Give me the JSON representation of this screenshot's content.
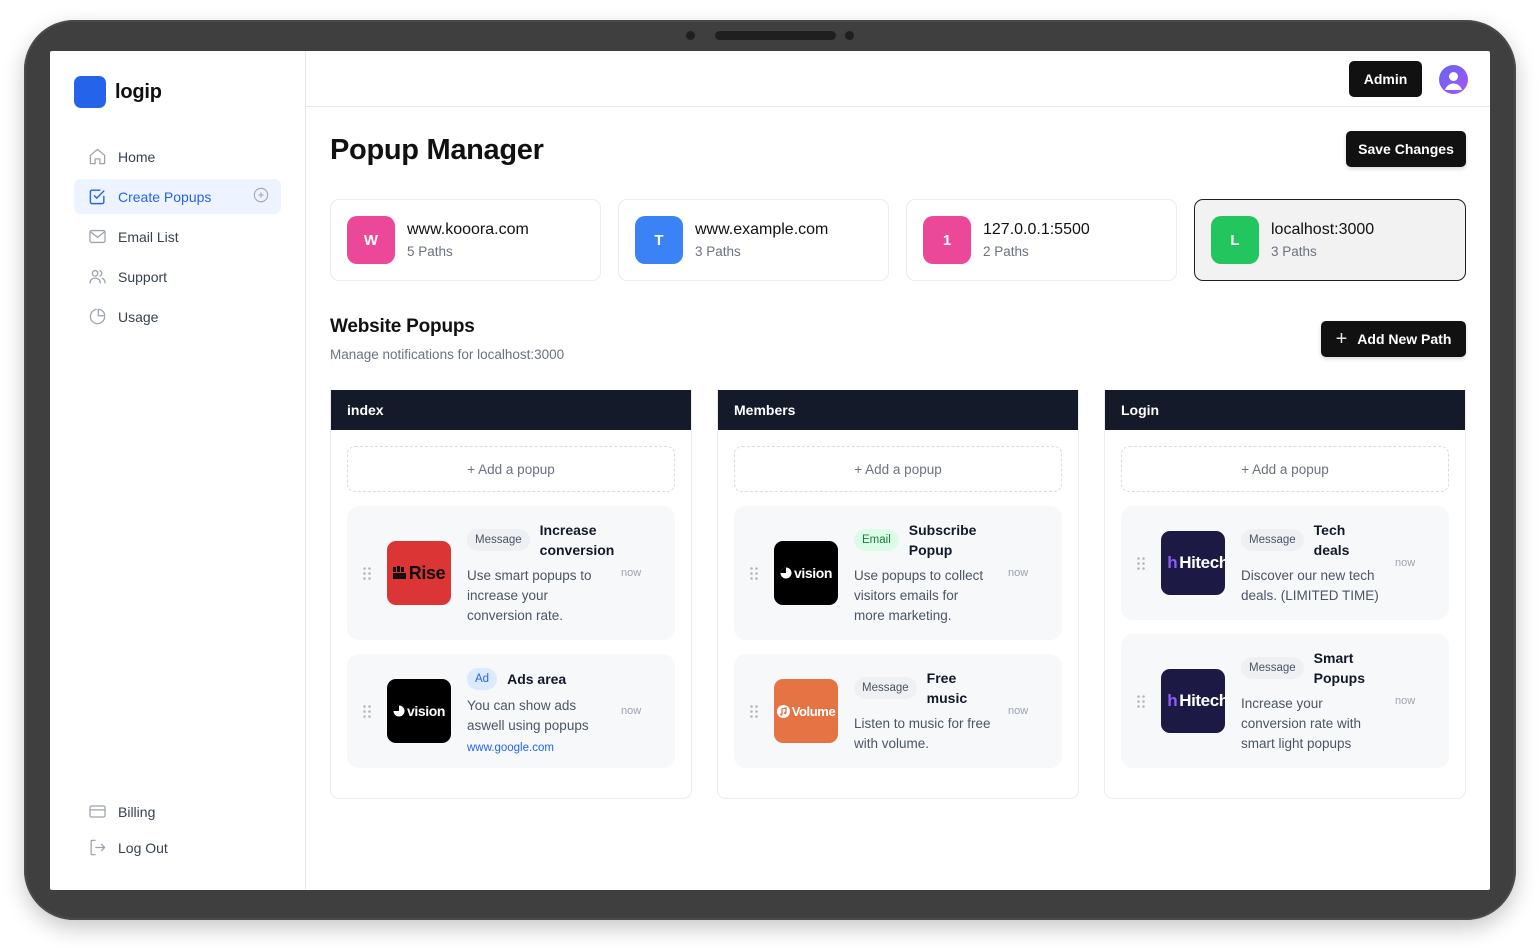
{
  "brand": {
    "name": "logip",
    "logo_color": "#2563eb"
  },
  "sidebar": {
    "items": [
      {
        "label": "Home",
        "icon": "home-icon",
        "active": false
      },
      {
        "label": "Create Popups",
        "icon": "checkbox-icon",
        "active": true,
        "action_icon": "plus-circle-icon"
      },
      {
        "label": "Email List",
        "icon": "mail-icon",
        "active": false
      },
      {
        "label": "Support",
        "icon": "users-icon",
        "active": false
      },
      {
        "label": "Usage",
        "icon": "pie-chart-icon",
        "active": false
      }
    ],
    "bottom_items": [
      {
        "label": "Billing",
        "icon": "credit-card-icon"
      },
      {
        "label": "Log Out",
        "icon": "logout-icon"
      }
    ]
  },
  "header": {
    "admin_label": "Admin",
    "avatar_icon": "user-avatar-icon"
  },
  "page": {
    "title": "Popup Manager",
    "save_label": "Save Changes"
  },
  "sites": [
    {
      "initial": "W",
      "name": "www.kooora.com",
      "paths": "5 Paths",
      "color": "#ec4899",
      "selected": false
    },
    {
      "initial": "T",
      "name": "www.example.com",
      "paths": "3 Paths",
      "color": "#3b82f6",
      "selected": false
    },
    {
      "initial": "1",
      "name": "127.0.0.1:5500",
      "paths": "2 Paths",
      "color": "#ec4899",
      "selected": false
    },
    {
      "initial": "L",
      "name": "localhost:3000",
      "paths": "3 Paths",
      "color": "#22c55e",
      "selected": true
    }
  ],
  "section": {
    "title": "Website Popups",
    "subtitle": "Manage notifications for localhost:3000",
    "add_path_label": "Add New Path"
  },
  "columns": [
    {
      "name": "index",
      "add_label": "+ Add a popup",
      "popups": [
        {
          "brand": "Rise",
          "brand_bg": "#dc3535",
          "tag": "Message",
          "tag_type": "message",
          "title": "Increase conversion",
          "description": "Use smart popups to increase your conversion rate.",
          "time": "now",
          "link": null
        },
        {
          "brand": "vision",
          "brand_bg": "#000000",
          "tag": "Ad",
          "tag_type": "ad",
          "title": "Ads area",
          "description": "You can show ads aswell using popups",
          "time": "now",
          "link": "www.google.com"
        }
      ]
    },
    {
      "name": "Members",
      "add_label": "+ Add a popup",
      "popups": [
        {
          "brand": "vision",
          "brand_bg": "#000000",
          "tag": "Email",
          "tag_type": "email",
          "title": "Subscribe Popup",
          "description": "Use popups to collect visitors emails for more marketing.",
          "time": "now",
          "link": null
        },
        {
          "brand": "Volume",
          "brand_bg": "#e57344",
          "tag": "Message",
          "tag_type": "message",
          "title": "Free music",
          "description": "Listen to music for free with volume.",
          "time": "now",
          "link": null
        }
      ]
    },
    {
      "name": "Login",
      "add_label": "+ Add a popup",
      "popups": [
        {
          "brand": "Hitech",
          "brand_bg": "#1c1a45",
          "tag": "Message",
          "tag_type": "message",
          "title": "Tech deals",
          "description": "Discover our new tech deals. (LIMITED TIME)",
          "time": "now",
          "link": null
        },
        {
          "brand": "Hitech",
          "brand_bg": "#1c1a45",
          "tag": "Message",
          "tag_type": "message",
          "title": "Smart Popups",
          "description": "Increase your conversion rate with smart light popups",
          "time": "now",
          "link": null
        }
      ]
    }
  ]
}
